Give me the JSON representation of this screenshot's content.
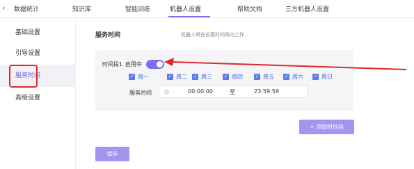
{
  "nav": {
    "back_icon": "chevron-left-icon",
    "tabs": [
      {
        "label": "数据统计"
      },
      {
        "label": "知识库"
      },
      {
        "label": "智能训练"
      },
      {
        "label": "机器人设置"
      },
      {
        "label": "帮助文档"
      },
      {
        "label": "三方机器人设置"
      }
    ],
    "active_tab": "机器人设置"
  },
  "sidebar": {
    "items": [
      {
        "label": "基础设置"
      },
      {
        "label": "引导设置"
      },
      {
        "label": "服务时间"
      },
      {
        "label": "高级设置"
      }
    ],
    "active_item": "服务时间"
  },
  "main": {
    "section_title": "服务时间",
    "section_desc": "机器人将在设置时间段内工作",
    "period": {
      "label": "时间段1",
      "status_label": "启用中",
      "enabled": true,
      "days": [
        {
          "label": "周一",
          "checked": true
        },
        {
          "label": "周二",
          "checked": true
        },
        {
          "label": "周三",
          "checked": true
        },
        {
          "label": "周四",
          "checked": true
        },
        {
          "label": "周五",
          "checked": true
        },
        {
          "label": "周六",
          "checked": true
        },
        {
          "label": "周日",
          "checked": true
        }
      ],
      "service_time_label": "服务时间",
      "start_time": "00:00:00",
      "separator": "至",
      "end_time": "23:59:59"
    },
    "add_button": "+ 添加时间段",
    "save_button": "保存"
  },
  "colors": {
    "accent": "#7c6ff0",
    "button": "#a396f2",
    "checkbox": "#5b7be8",
    "annotation_red": "#e0282a"
  }
}
